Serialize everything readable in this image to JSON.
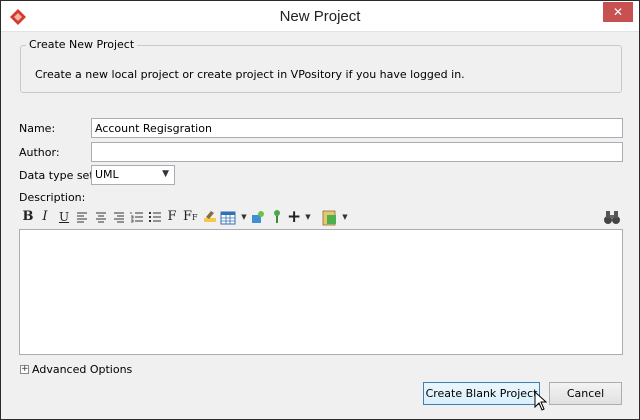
{
  "window": {
    "title": "New Project",
    "close_glyph": "✕",
    "icons": {
      "logo": "app-logo-icon",
      "close": "close-icon"
    }
  },
  "group": {
    "legend": "Create New Project",
    "description": "Create a new local project or create project in VPository if you have logged in."
  },
  "form": {
    "name_label": "Name:",
    "name_value": "Account Regisgration",
    "author_label": "Author:",
    "author_value": "",
    "datatype_label": "Data type set:",
    "datatype_value": "UML",
    "description_label": "Description:"
  },
  "toolbar": {
    "bold": "B",
    "italic": "I",
    "underline": "U",
    "font": "F",
    "font_size": "F",
    "font_size_sub": "F",
    "add": "+",
    "drop": "▼"
  },
  "advanced": {
    "toggle": "+",
    "label": "Advanced Options"
  },
  "buttons": {
    "create_blank": "Create Blank Project",
    "cancel": "Cancel"
  },
  "colors": {
    "close": "#c75050",
    "accent": "#3c7fb1"
  }
}
